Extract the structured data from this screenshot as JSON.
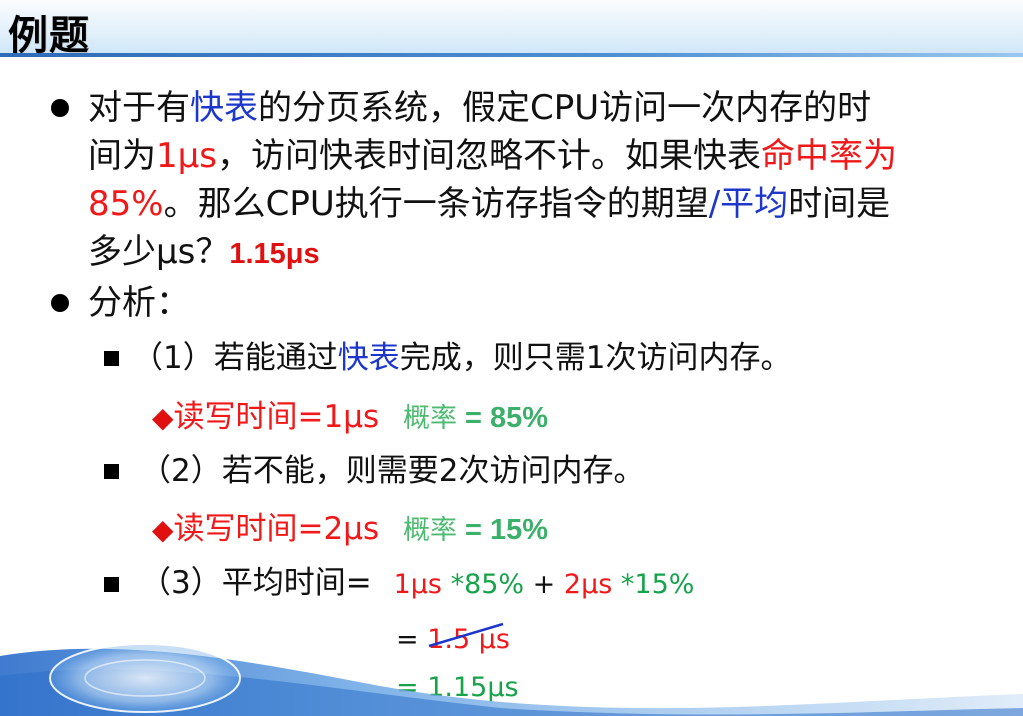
{
  "header": {
    "title": "例题"
  },
  "question": {
    "l1_a": "对于有",
    "l1_b": "快表",
    "l1_c": "的分页系统，假定CPU访问一次内存的时",
    "l2_a": "间为",
    "l2_b": "1μs",
    "l2_c": "，访问快表时间忽略不计。如果快表",
    "l2_d": "命中率为",
    "l3_a": "85%",
    "l3_b": "。那么CPU执行一条访存指令的期望",
    "l3_c": "/平均",
    "l3_d": "时间是",
    "l4_a": "多少μs？",
    "l4_b": "1.15μs"
  },
  "analysis": {
    "title": "分析：",
    "s1_a": "（1）若能通过",
    "s1_b": "快表",
    "s1_c": "完成，则只需1次访问内存。",
    "d1_a": "◆",
    "d1_b": "读写时间=1μs",
    "d1_c": "概率",
    "d1_d": " = 85%",
    "s2": "（2）若不能，则需要2次访问内存。",
    "d2_a": "◆",
    "d2_b": "读写时间=2μs",
    "d2_c": "概率",
    "d2_d": " = 15%",
    "s3_a": "（3）平均时间=",
    "s3_b": "1μs ",
    "s3_c": "*85%",
    "s3_d": " +  ",
    "s3_e": "2μs ",
    "s3_f": "*15%",
    "eq1_a": "= ",
    "eq1_b": "1.5  μs",
    "eq2": "= 1.15μs"
  },
  "colors": {
    "blue": "#1c37c9",
    "red": "#f01818",
    "green": "#4dba71",
    "dark_green": "#16a34a"
  }
}
